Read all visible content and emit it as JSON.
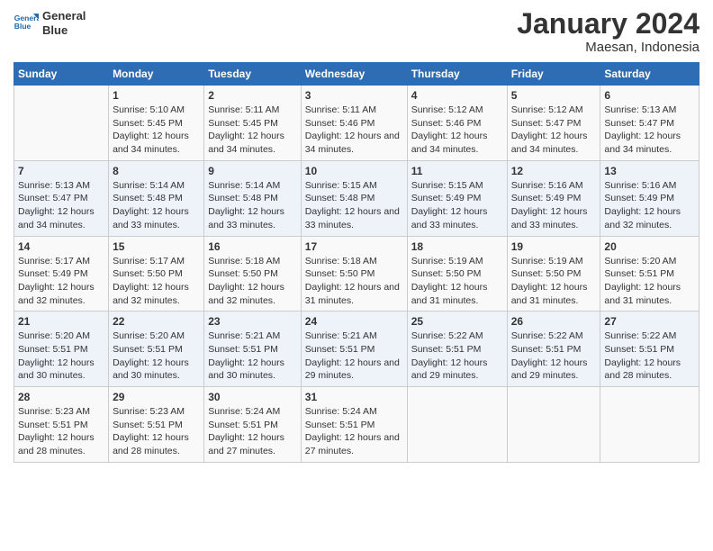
{
  "header": {
    "logo_line1": "General",
    "logo_line2": "Blue",
    "month_title": "January 2024",
    "location": "Maesan, Indonesia"
  },
  "columns": [
    "Sunday",
    "Monday",
    "Tuesday",
    "Wednesday",
    "Thursday",
    "Friday",
    "Saturday"
  ],
  "weeks": [
    [
      {
        "day": "",
        "sunrise": "",
        "sunset": "",
        "daylight": ""
      },
      {
        "day": "1",
        "sunrise": "Sunrise: 5:10 AM",
        "sunset": "Sunset: 5:45 PM",
        "daylight": "Daylight: 12 hours and 34 minutes."
      },
      {
        "day": "2",
        "sunrise": "Sunrise: 5:11 AM",
        "sunset": "Sunset: 5:45 PM",
        "daylight": "Daylight: 12 hours and 34 minutes."
      },
      {
        "day": "3",
        "sunrise": "Sunrise: 5:11 AM",
        "sunset": "Sunset: 5:46 PM",
        "daylight": "Daylight: 12 hours and 34 minutes."
      },
      {
        "day": "4",
        "sunrise": "Sunrise: 5:12 AM",
        "sunset": "Sunset: 5:46 PM",
        "daylight": "Daylight: 12 hours and 34 minutes."
      },
      {
        "day": "5",
        "sunrise": "Sunrise: 5:12 AM",
        "sunset": "Sunset: 5:47 PM",
        "daylight": "Daylight: 12 hours and 34 minutes."
      },
      {
        "day": "6",
        "sunrise": "Sunrise: 5:13 AM",
        "sunset": "Sunset: 5:47 PM",
        "daylight": "Daylight: 12 hours and 34 minutes."
      }
    ],
    [
      {
        "day": "7",
        "sunrise": "Sunrise: 5:13 AM",
        "sunset": "Sunset: 5:47 PM",
        "daylight": "Daylight: 12 hours and 34 minutes."
      },
      {
        "day": "8",
        "sunrise": "Sunrise: 5:14 AM",
        "sunset": "Sunset: 5:48 PM",
        "daylight": "Daylight: 12 hours and 33 minutes."
      },
      {
        "day": "9",
        "sunrise": "Sunrise: 5:14 AM",
        "sunset": "Sunset: 5:48 PM",
        "daylight": "Daylight: 12 hours and 33 minutes."
      },
      {
        "day": "10",
        "sunrise": "Sunrise: 5:15 AM",
        "sunset": "Sunset: 5:48 PM",
        "daylight": "Daylight: 12 hours and 33 minutes."
      },
      {
        "day": "11",
        "sunrise": "Sunrise: 5:15 AM",
        "sunset": "Sunset: 5:49 PM",
        "daylight": "Daylight: 12 hours and 33 minutes."
      },
      {
        "day": "12",
        "sunrise": "Sunrise: 5:16 AM",
        "sunset": "Sunset: 5:49 PM",
        "daylight": "Daylight: 12 hours and 33 minutes."
      },
      {
        "day": "13",
        "sunrise": "Sunrise: 5:16 AM",
        "sunset": "Sunset: 5:49 PM",
        "daylight": "Daylight: 12 hours and 32 minutes."
      }
    ],
    [
      {
        "day": "14",
        "sunrise": "Sunrise: 5:17 AM",
        "sunset": "Sunset: 5:49 PM",
        "daylight": "Daylight: 12 hours and 32 minutes."
      },
      {
        "day": "15",
        "sunrise": "Sunrise: 5:17 AM",
        "sunset": "Sunset: 5:50 PM",
        "daylight": "Daylight: 12 hours and 32 minutes."
      },
      {
        "day": "16",
        "sunrise": "Sunrise: 5:18 AM",
        "sunset": "Sunset: 5:50 PM",
        "daylight": "Daylight: 12 hours and 32 minutes."
      },
      {
        "day": "17",
        "sunrise": "Sunrise: 5:18 AM",
        "sunset": "Sunset: 5:50 PM",
        "daylight": "Daylight: 12 hours and 31 minutes."
      },
      {
        "day": "18",
        "sunrise": "Sunrise: 5:19 AM",
        "sunset": "Sunset: 5:50 PM",
        "daylight": "Daylight: 12 hours and 31 minutes."
      },
      {
        "day": "19",
        "sunrise": "Sunrise: 5:19 AM",
        "sunset": "Sunset: 5:50 PM",
        "daylight": "Daylight: 12 hours and 31 minutes."
      },
      {
        "day": "20",
        "sunrise": "Sunrise: 5:20 AM",
        "sunset": "Sunset: 5:51 PM",
        "daylight": "Daylight: 12 hours and 31 minutes."
      }
    ],
    [
      {
        "day": "21",
        "sunrise": "Sunrise: 5:20 AM",
        "sunset": "Sunset: 5:51 PM",
        "daylight": "Daylight: 12 hours and 30 minutes."
      },
      {
        "day": "22",
        "sunrise": "Sunrise: 5:20 AM",
        "sunset": "Sunset: 5:51 PM",
        "daylight": "Daylight: 12 hours and 30 minutes."
      },
      {
        "day": "23",
        "sunrise": "Sunrise: 5:21 AM",
        "sunset": "Sunset: 5:51 PM",
        "daylight": "Daylight: 12 hours and 30 minutes."
      },
      {
        "day": "24",
        "sunrise": "Sunrise: 5:21 AM",
        "sunset": "Sunset: 5:51 PM",
        "daylight": "Daylight: 12 hours and 29 minutes."
      },
      {
        "day": "25",
        "sunrise": "Sunrise: 5:22 AM",
        "sunset": "Sunset: 5:51 PM",
        "daylight": "Daylight: 12 hours and 29 minutes."
      },
      {
        "day": "26",
        "sunrise": "Sunrise: 5:22 AM",
        "sunset": "Sunset: 5:51 PM",
        "daylight": "Daylight: 12 hours and 29 minutes."
      },
      {
        "day": "27",
        "sunrise": "Sunrise: 5:22 AM",
        "sunset": "Sunset: 5:51 PM",
        "daylight": "Daylight: 12 hours and 28 minutes."
      }
    ],
    [
      {
        "day": "28",
        "sunrise": "Sunrise: 5:23 AM",
        "sunset": "Sunset: 5:51 PM",
        "daylight": "Daylight: 12 hours and 28 minutes."
      },
      {
        "day": "29",
        "sunrise": "Sunrise: 5:23 AM",
        "sunset": "Sunset: 5:51 PM",
        "daylight": "Daylight: 12 hours and 28 minutes."
      },
      {
        "day": "30",
        "sunrise": "Sunrise: 5:24 AM",
        "sunset": "Sunset: 5:51 PM",
        "daylight": "Daylight: 12 hours and 27 minutes."
      },
      {
        "day": "31",
        "sunrise": "Sunrise: 5:24 AM",
        "sunset": "Sunset: 5:51 PM",
        "daylight": "Daylight: 12 hours and 27 minutes."
      },
      {
        "day": "",
        "sunrise": "",
        "sunset": "",
        "daylight": ""
      },
      {
        "day": "",
        "sunrise": "",
        "sunset": "",
        "daylight": ""
      },
      {
        "day": "",
        "sunrise": "",
        "sunset": "",
        "daylight": ""
      }
    ]
  ]
}
